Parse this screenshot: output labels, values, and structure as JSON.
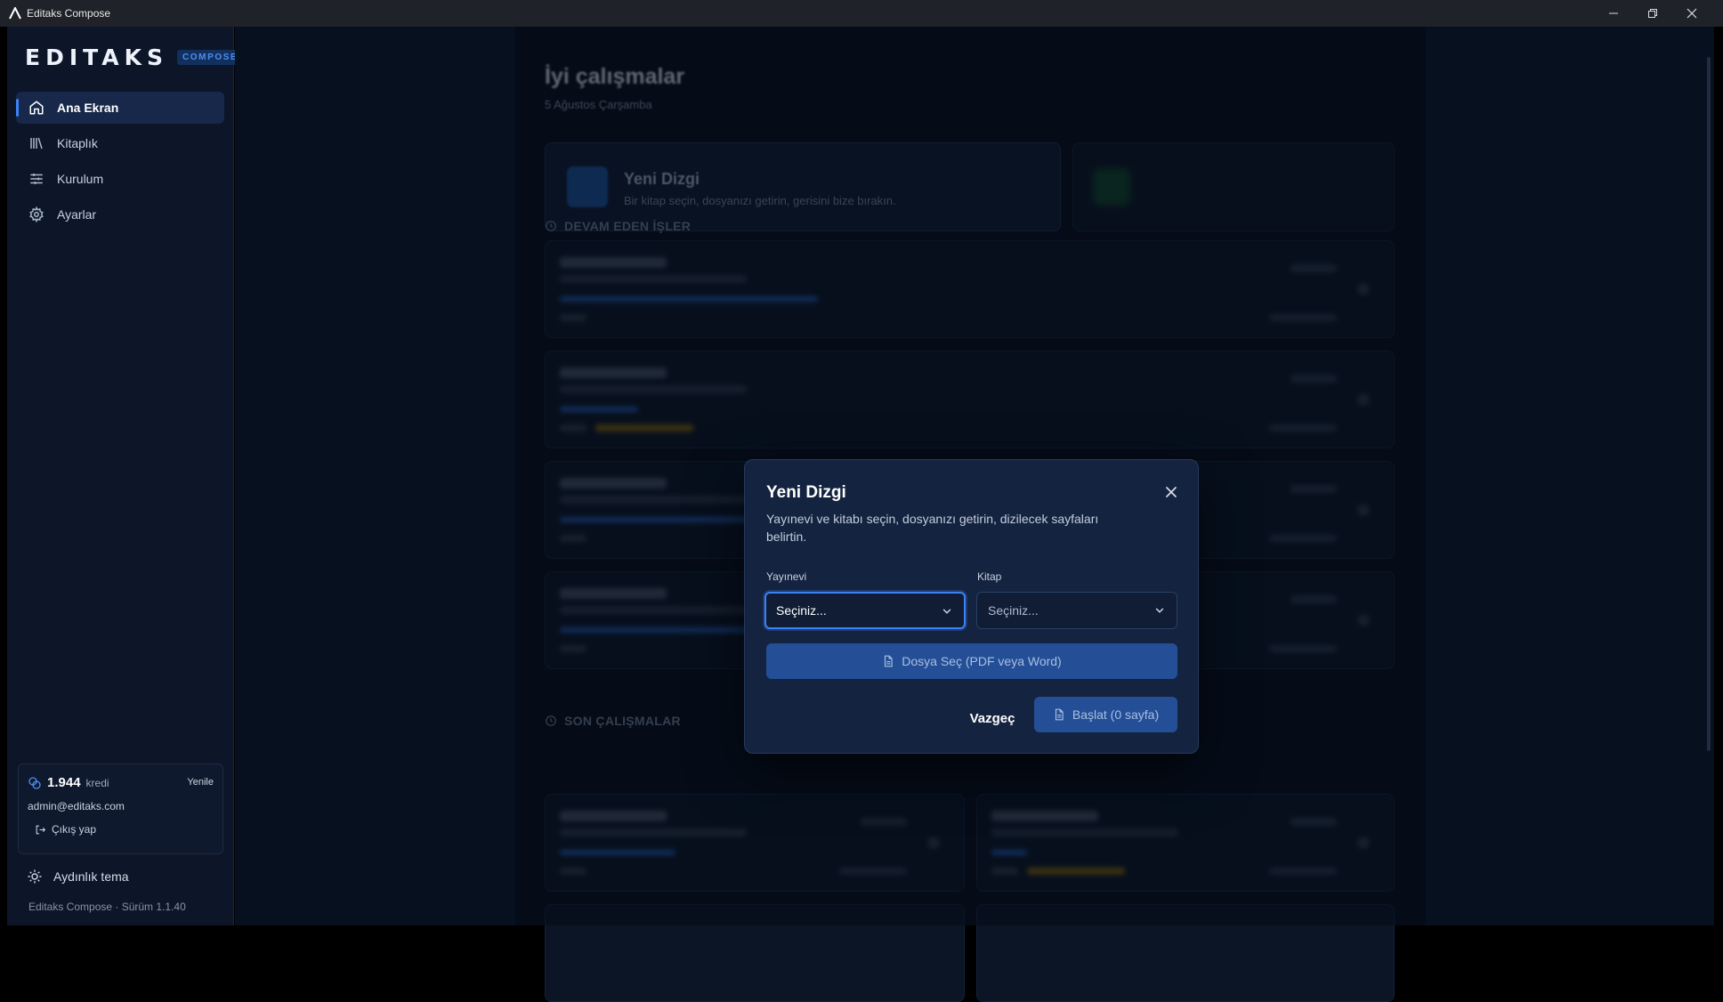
{
  "window": {
    "title": "Editaks Compose"
  },
  "brand": {
    "wordmark": "EDITAKS",
    "badge": "COMPOSE"
  },
  "sidebar": {
    "items": [
      {
        "label": "Ana Ekran",
        "icon": "home-icon",
        "active": true
      },
      {
        "label": "Kitaplık",
        "icon": "library-icon",
        "active": false
      },
      {
        "label": "Kurulum",
        "icon": "sliders-icon",
        "active": false
      },
      {
        "label": "Ayarlar",
        "icon": "gear-icon",
        "active": false
      }
    ],
    "credits": {
      "value": "1.944",
      "unit": "kredi",
      "refresh_label": "Yenile"
    },
    "email": "admin@editaks.com",
    "logout_label": "Çıkış yap",
    "theme_label": "Aydınlık tema",
    "version": "Editaks Compose · Sürüm 1.1.40"
  },
  "main": {
    "greeting": "İyi çalışmalar",
    "date": "5 Ağustos Çarşamba",
    "new_card": {
      "title": "Yeni Dizgi",
      "subtitle": "Bir kitap seçin, dosyanızı getirin, gerisini bize bırakın."
    },
    "sections": {
      "ongoing": "DEVAM EDEN İŞLER",
      "recent": "SON ÇALIŞMALAR"
    }
  },
  "modal": {
    "title": "Yeni Dizgi",
    "description": "Yayınevi ve kitabı seçin, dosyanızı getirin, dizilecek sayfaları belirtin.",
    "publisher": {
      "label": "Yayınevi",
      "value": "Seçiniz..."
    },
    "book": {
      "label": "Kitap",
      "value": "Seçiniz..."
    },
    "file_button": "Dosya Seç (PDF veya Word)",
    "cancel": "Vazgeç",
    "start": "Başlat (0 sayfa)"
  },
  "colors": {
    "accent": "#3b82f6",
    "primary_button": "#244f96",
    "sidebar_bg": "#0c1628",
    "modal_bg": "#14233f"
  }
}
